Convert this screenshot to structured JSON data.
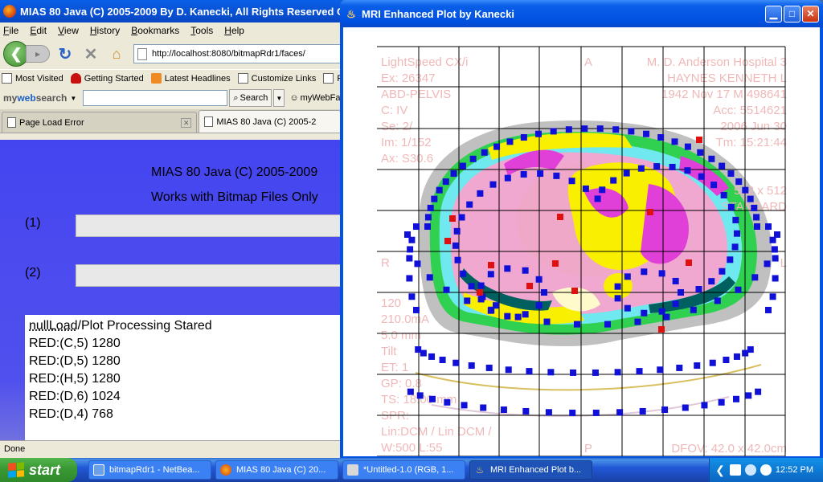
{
  "firefox": {
    "title": "MIAS 80 Java (C) 2005-2009 By D. Kanecki, All Rights Reserved C",
    "menu": [
      "File",
      "Edit",
      "View",
      "History",
      "Bookmarks",
      "Tools",
      "Help"
    ],
    "url": "http://localhost:8080/bitmapRdr1/faces/",
    "bookmarks": [
      "Most Visited",
      "Getting Started",
      "Latest Headlines",
      "Customize Links",
      "F"
    ],
    "search_logo_prefix": "my",
    "search_logo_bold": "web",
    "search_logo_suffix": "search",
    "search_button": "Search",
    "search_extra": "myWebFa",
    "tabs": [
      "Page Load Error",
      "MIAS 80 Java (C) 2005-2"
    ],
    "heading1": "MIAS 80 Java (C) 2005-2009",
    "heading2": "Works with Bitmap Files Only",
    "label1": "(1)",
    "label2": "(2)",
    "log_first_u": "nullLoad",
    "log_first_rest": "/Plot Processing Stared",
    "log": [
      "RED:(C,5) 1280",
      "RED:(D,5) 1280",
      "RED:(H,5) 1280",
      "RED:(D,6) 1024",
      "RED:(D,4) 768"
    ],
    "status": "Done"
  },
  "mri_window": {
    "title": "MRI Enhanced Plot by Kanecki"
  },
  "mri_overlay": {
    "left": [
      "LightSpeed CX/i",
      "Ex: 26347",
      "ABD-PELVIS",
      "C: IV",
      "Se: 2/",
      "Im: 1/152",
      "Ax: S30.6",
      "R",
      "120",
      "210.0mA",
      "5.0 mm",
      "Tilt",
      "ET: 1",
      "GP: 0.8",
      "TS: 18.00 mm",
      "SPR:",
      "Lin:DCM / Lin DCM /",
      "W:500  L:55"
    ],
    "right": [
      "M. D. Anderson Hospital 3",
      "HAYNES KENNETH L",
      "1942 Nov 17  M  498641",
      "Acc: 5514621",
      "2006 Jun 30",
      "Tm: 15:21:44",
      "512 x 512",
      "STANDARD",
      "L",
      "DFOV: 42.0 x 42.0cm"
    ],
    "top_center": "A",
    "bottom_center": "P"
  },
  "taskbar": {
    "start": "start",
    "tasks": [
      "bitmapRdr1 - NetBea...",
      "MIAS 80 Java (C) 20...",
      "*Untitled-1.0 (RGB, 1...",
      "MRI Enhanced Plot b..."
    ],
    "clock": "12:52 PM"
  },
  "colors": {
    "page_background": "#4545f0",
    "red_marker": "#e01010",
    "blue_marker": "#1010d8",
    "mri_yellow": "#f8f000",
    "mri_magenta": "#e040d8",
    "mri_green": "#20d040"
  }
}
